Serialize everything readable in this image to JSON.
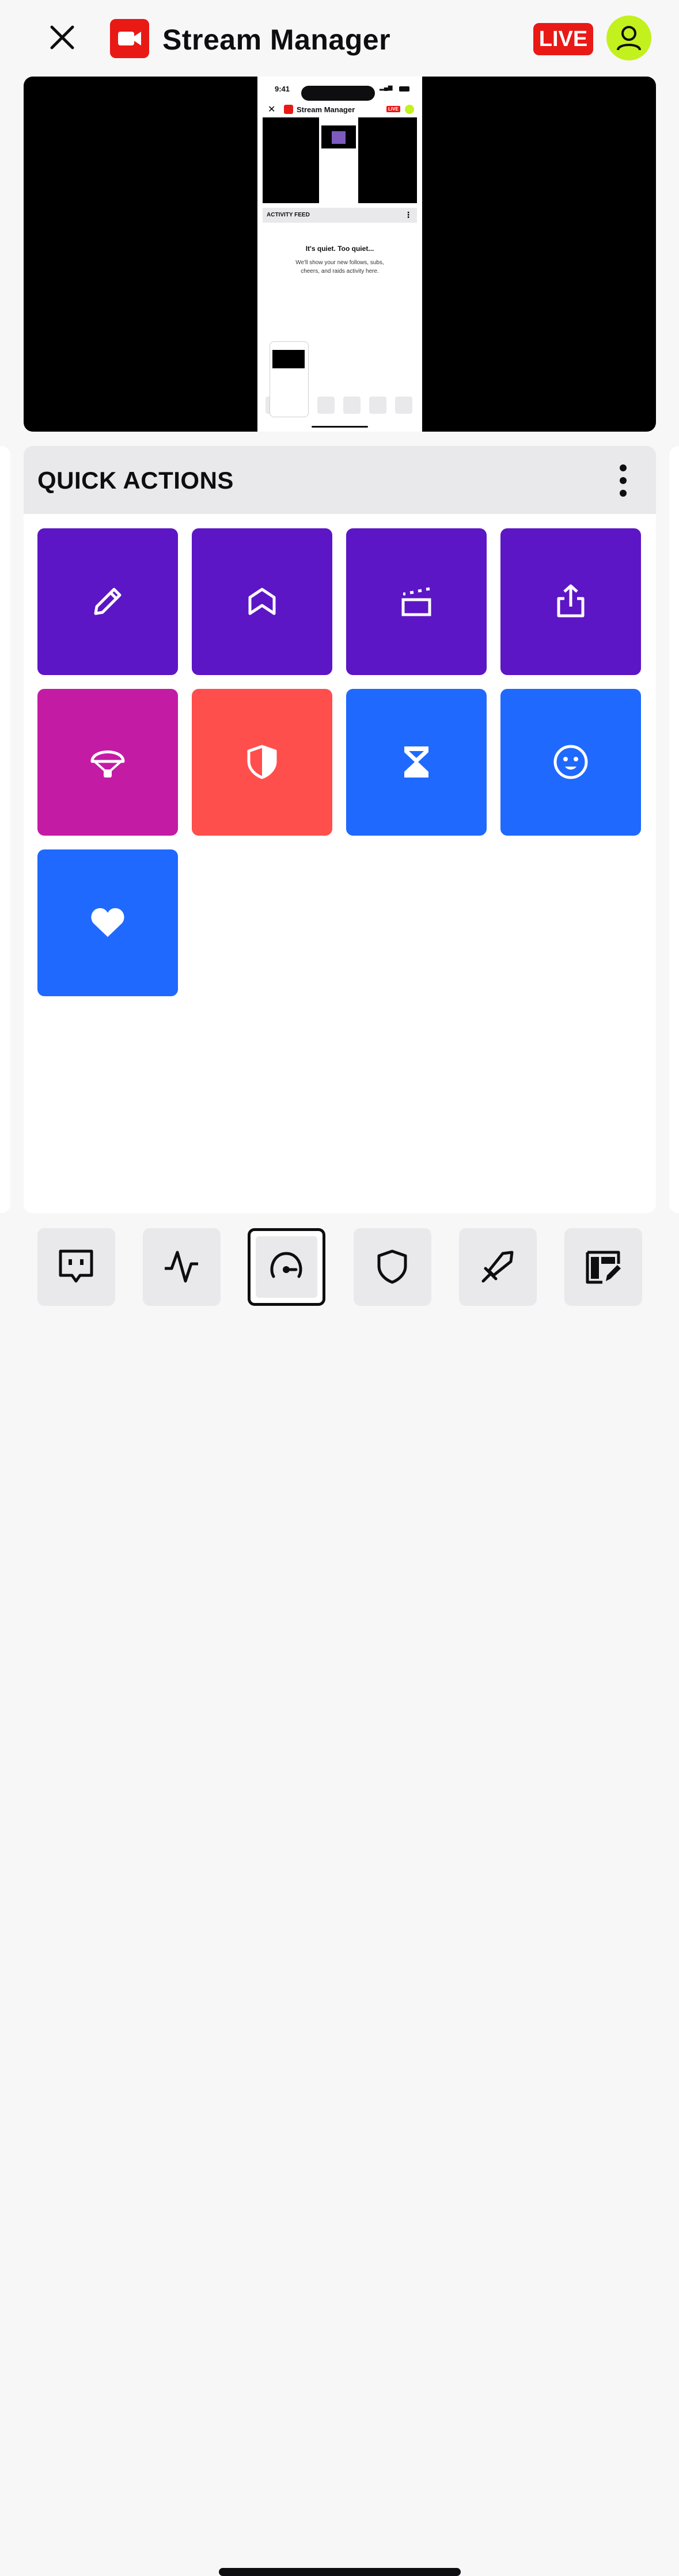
{
  "header": {
    "title": "Stream Manager",
    "live_label": "LIVE",
    "brand_color": "#e91916",
    "avatar_color": "#c2f11e"
  },
  "preview": {
    "status_time": "9:41",
    "mini_title": "Stream Manager",
    "mini_live": "LIVE",
    "activity_feed_title": "ACTIVITY FEED",
    "empty_title": "It's quiet. Too quiet...",
    "empty_text": "We'll show your new follows, subs, cheers, and raids activity here."
  },
  "quick_actions": {
    "title": "QUICK ACTIONS",
    "tiles": [
      {
        "icon": "pencil-icon",
        "color": "#5c16c5"
      },
      {
        "icon": "bookmark-flag-icon",
        "color": "#5c16c5"
      },
      {
        "icon": "clapperboard-icon",
        "color": "#5c16c5"
      },
      {
        "icon": "share-icon",
        "color": "#5c16c5"
      },
      {
        "icon": "parachute-icon",
        "color": "#c41ba5"
      },
      {
        "icon": "shield-icon",
        "color": "#ff4f4d"
      },
      {
        "icon": "hourglass-icon",
        "color": "#1f69ff"
      },
      {
        "icon": "smiley-icon",
        "color": "#1f69ff"
      },
      {
        "icon": "heart-icon",
        "color": "#1f69ff"
      }
    ]
  },
  "bottom_nav": {
    "items": [
      {
        "icon": "chat-icon"
      },
      {
        "icon": "activity-icon"
      },
      {
        "icon": "gauge-icon",
        "active": true
      },
      {
        "icon": "shield-icon"
      },
      {
        "icon": "sword-icon"
      },
      {
        "icon": "dashboard-edit-icon"
      }
    ]
  }
}
